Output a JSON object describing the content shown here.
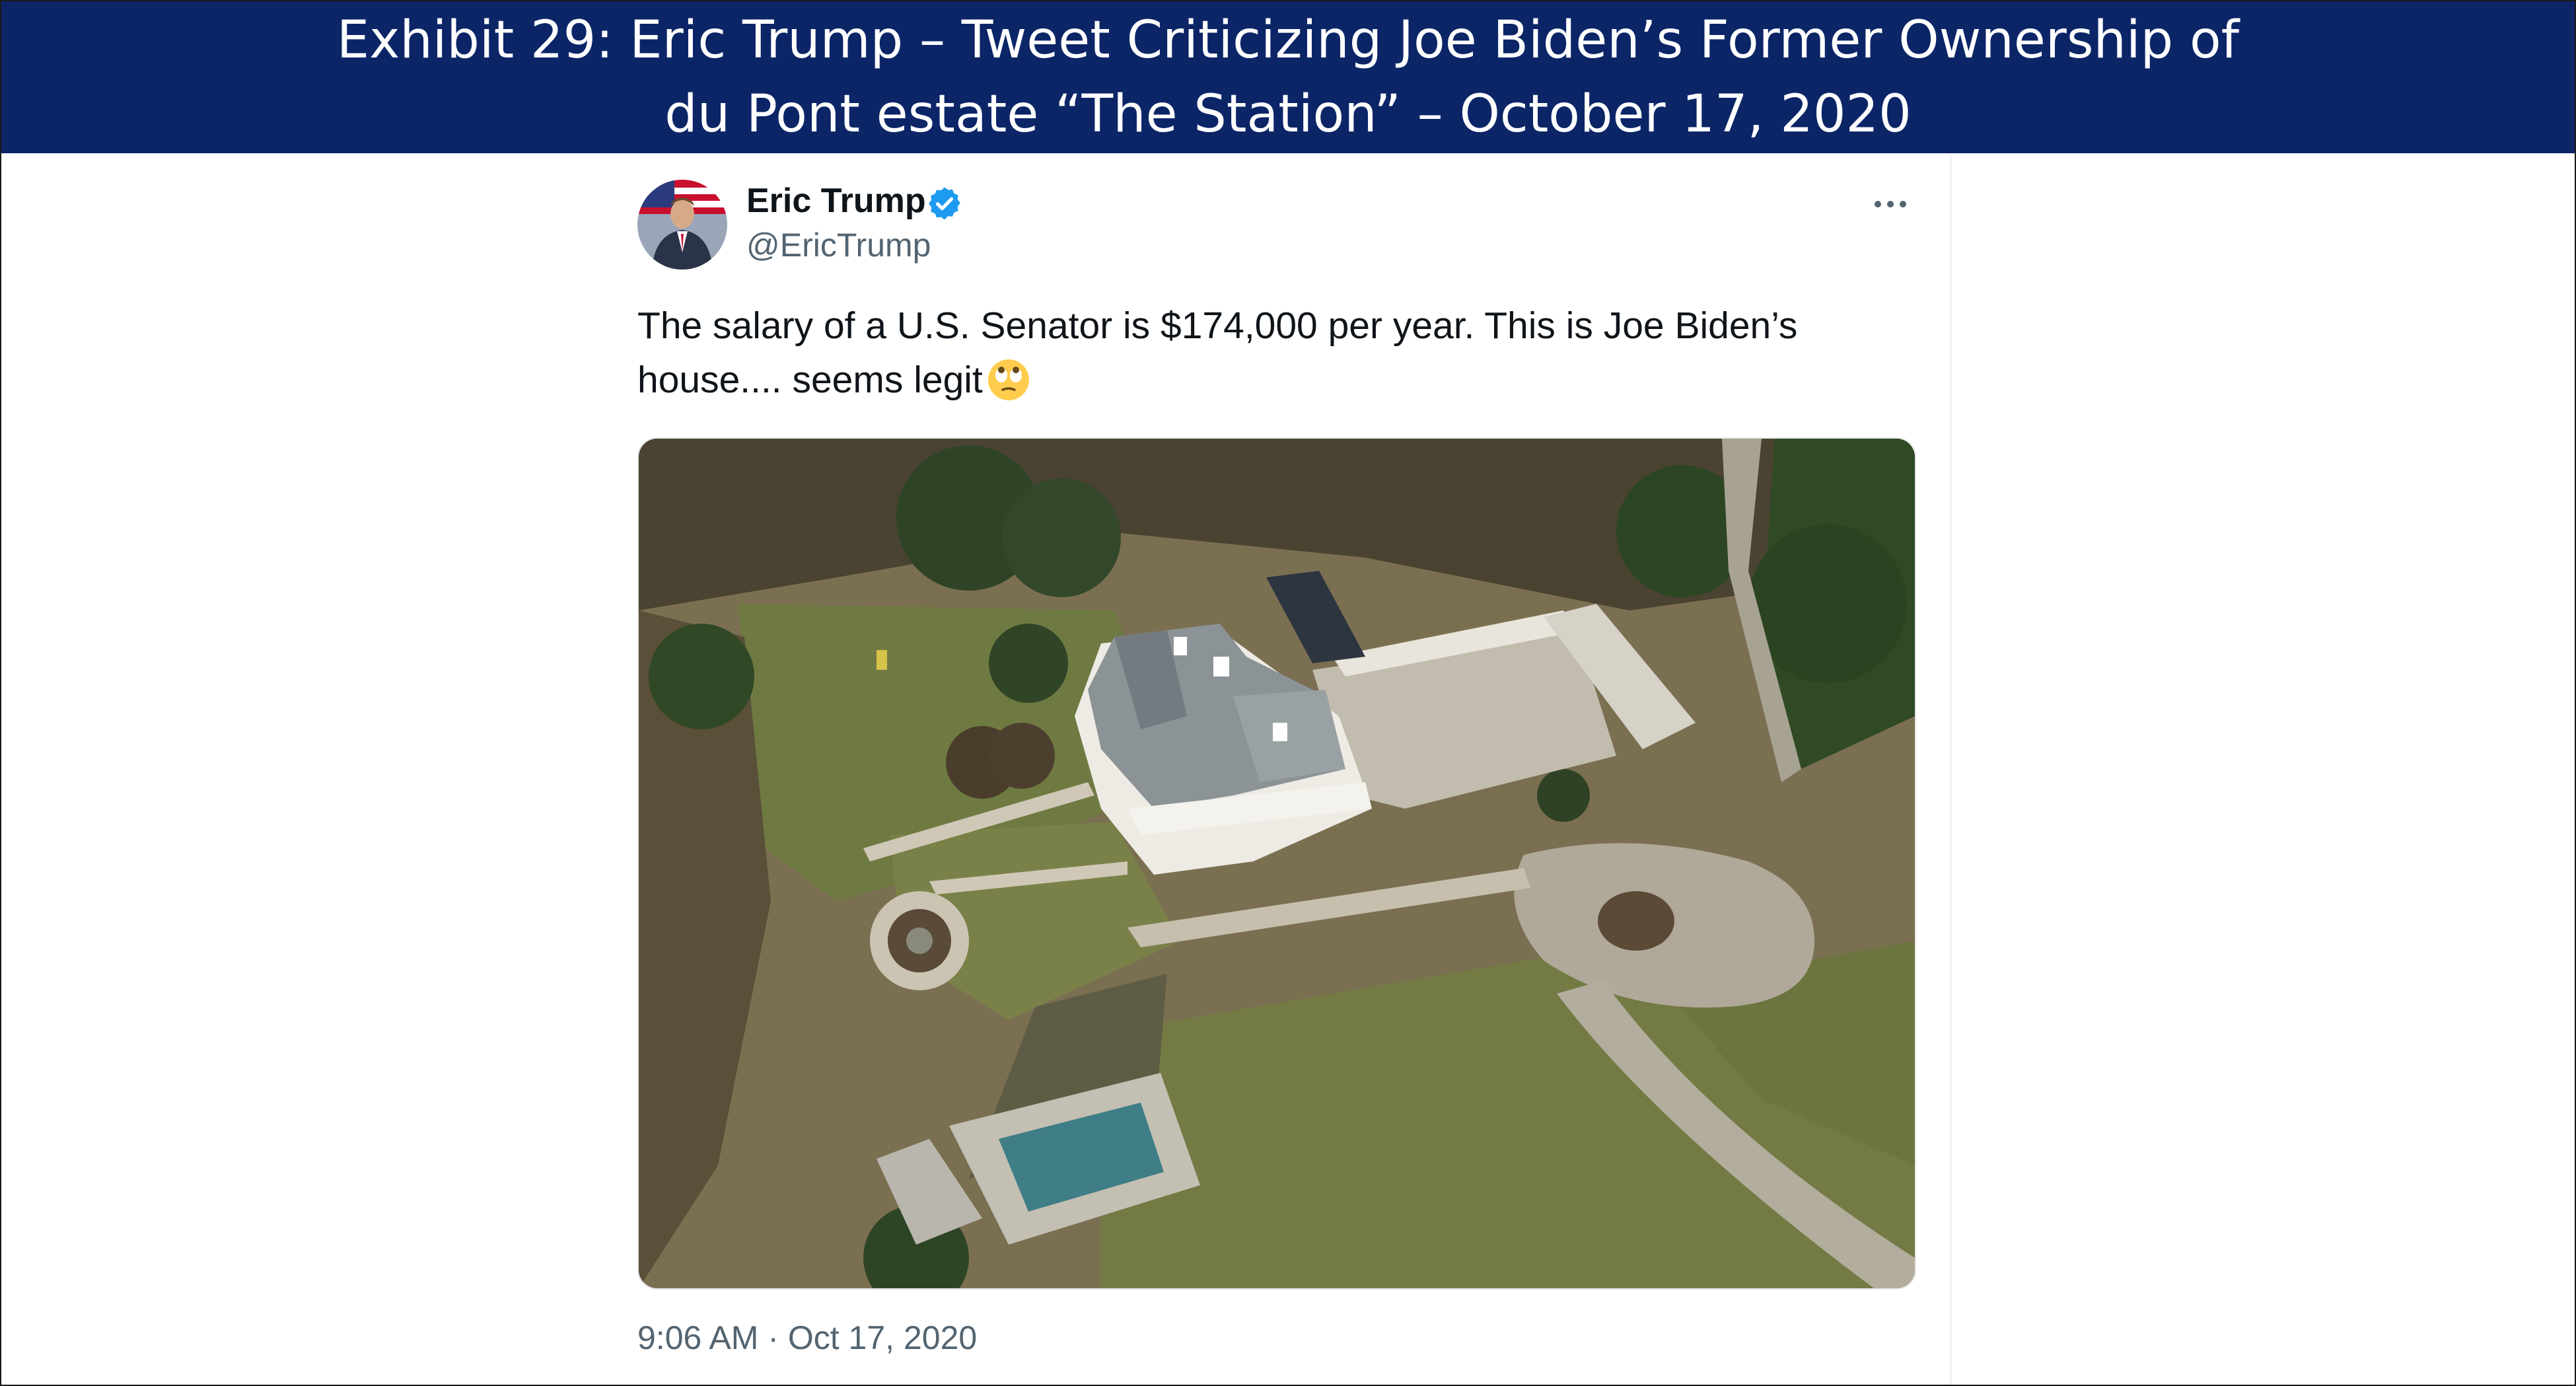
{
  "exhibit": {
    "title_line1": "Exhibit 29: Eric Trump – Tweet Criticizing Joe Biden’s Former Ownership of",
    "title_line2": "du Pont estate “The Station” – October 17, 2020",
    "banner_color": "#0b2567"
  },
  "tweet": {
    "author_name": "Eric Trump",
    "handle": "@EricTrump",
    "verified_icon": "verified-badge-icon",
    "verified_color": "#1d9bf0",
    "text": "The salary of a U.S. Senator is $174,000 per year. This is Joe Biden’s house.... seems legit",
    "emoji": "face-with-rolling-eyes-emoji",
    "photo": "aerial-photo-of-estate",
    "timestamp": "9:06 AM · Oct 17, 2020"
  }
}
